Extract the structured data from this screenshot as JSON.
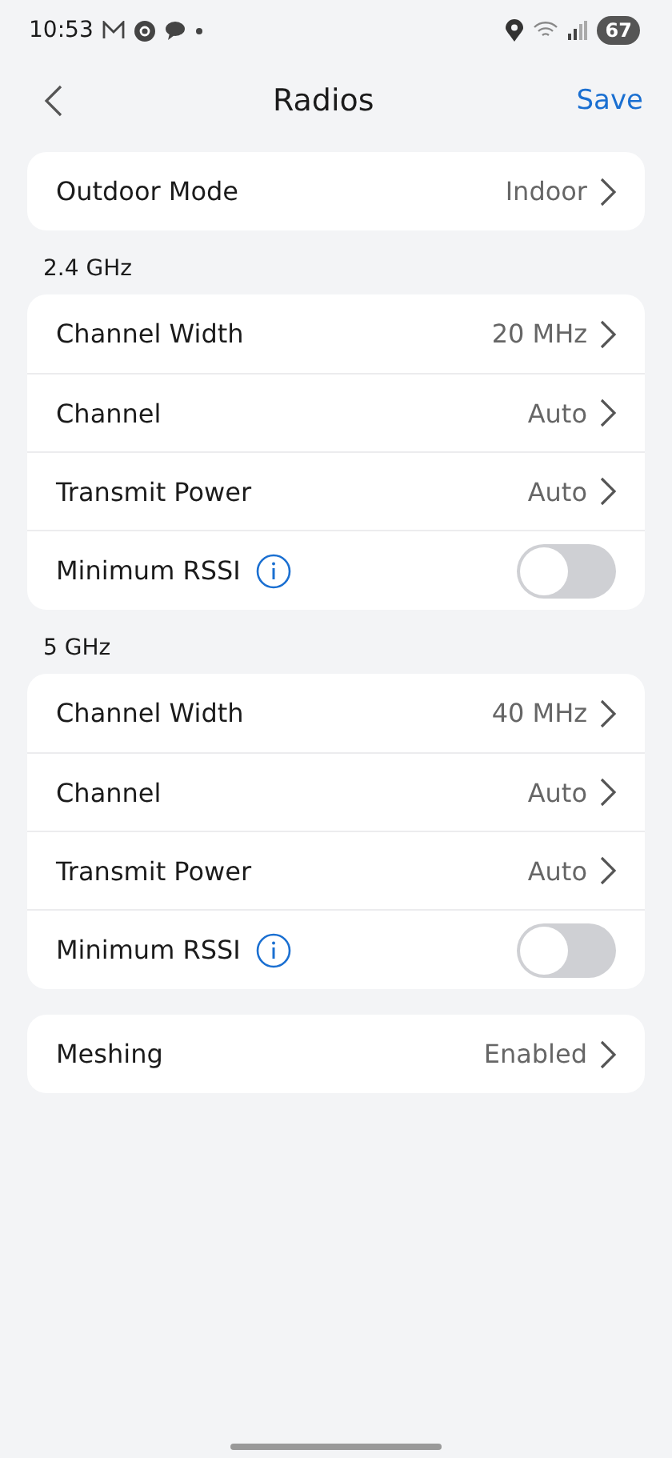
{
  "status_bar": {
    "time": "10:53",
    "battery": "67"
  },
  "header": {
    "title": "Radios",
    "action": "Save"
  },
  "sections": [
    {
      "rows": [
        {
          "kind": "value",
          "label": "Outdoor Mode",
          "value": "Indoor"
        }
      ]
    },
    {
      "title": "2.4 GHz",
      "rows": [
        {
          "kind": "value",
          "label": "Channel Width",
          "value": "20 MHz"
        },
        {
          "kind": "value",
          "label": "Channel",
          "value": "Auto"
        },
        {
          "kind": "value",
          "label": "Transmit Power",
          "value": "Auto"
        },
        {
          "kind": "toggle",
          "label": "Minimum RSSI",
          "on": false
        }
      ]
    },
    {
      "title": "5 GHz",
      "rows": [
        {
          "kind": "value",
          "label": "Channel Width",
          "value": "40 MHz"
        },
        {
          "kind": "value",
          "label": "Channel",
          "value": "Auto"
        },
        {
          "kind": "value",
          "label": "Transmit Power",
          "value": "Auto"
        },
        {
          "kind": "toggle",
          "label": "Minimum RSSI",
          "on": false
        }
      ]
    },
    {
      "rows": [
        {
          "kind": "value",
          "label": "Meshing",
          "value": "Enabled"
        }
      ]
    }
  ]
}
